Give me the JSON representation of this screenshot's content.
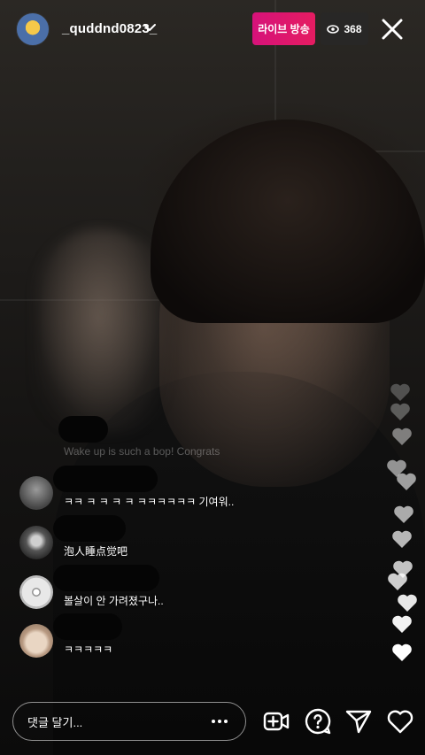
{
  "header": {
    "username": "_quddnd0823_",
    "live_label": "라이브 방송",
    "viewer_count": "368"
  },
  "comments": {
    "faded_text": "Wake up is such a bop! Congrats",
    "items": [
      {
        "text": "ㅋㅋ ㅋ ㅋ ㅋ ㅋ ㅋㅋㅋㅋㅋㅋ 기여워.."
      },
      {
        "text": "泡人睡点觉吧"
      },
      {
        "text": "볼살이 안 가려졌구나.."
      },
      {
        "text": "ㅋㅋㅋㅋㅋ"
      }
    ]
  },
  "footer": {
    "comment_placeholder": "댓글 달기..."
  },
  "colors": {
    "live_badge": "#e01a6a",
    "heart": "#ffffff"
  }
}
